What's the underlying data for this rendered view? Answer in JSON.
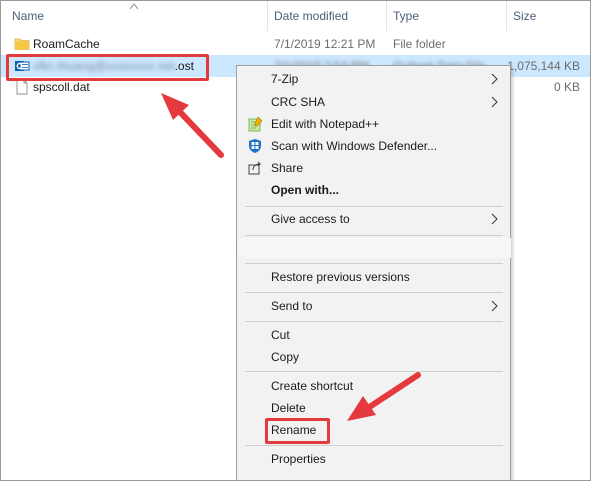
{
  "columns": {
    "name": "Name",
    "date_modified": "Date modified",
    "type": "Type",
    "size": "Size"
  },
  "files": [
    {
      "name": "RoamCache",
      "date": "7/1/2019 12:21 PM",
      "type": "File folder",
      "size": "",
      "icon": "folder-icon"
    },
    {
      "name_blurred": "xfkc.thuang@xxxxxxxx.net",
      "extension": ".ost",
      "date": "7/1/2019 2:54 PM",
      "type": "Outlook Data File",
      "size": "1,075,144 KB",
      "icon": "outlook-data-file-icon",
      "selected": true
    },
    {
      "name": "spscoll.dat",
      "date": "",
      "type": "",
      "size": "0 KB",
      "icon": "file-icon"
    }
  ],
  "context_menu": {
    "seven_zip": "7-Zip",
    "crc_sha": "CRC SHA",
    "edit_notepad": "Edit with Notepad++",
    "scan_defender": "Scan with Windows Defender...",
    "share": "Share",
    "open_with": "Open with...",
    "give_access": "Give access to",
    "restore_versions": "Restore previous versions",
    "send_to": "Send to",
    "cut": "Cut",
    "copy": "Copy",
    "create_shortcut": "Create shortcut",
    "delete": "Delete",
    "rename": "Rename",
    "properties": "Properties"
  },
  "colors": {
    "selection": "#cce8ff",
    "annotation": "#e4393d",
    "header_text": "#4c607a",
    "menu_bg": "#f2f2f2",
    "folder": "#f8d775"
  }
}
